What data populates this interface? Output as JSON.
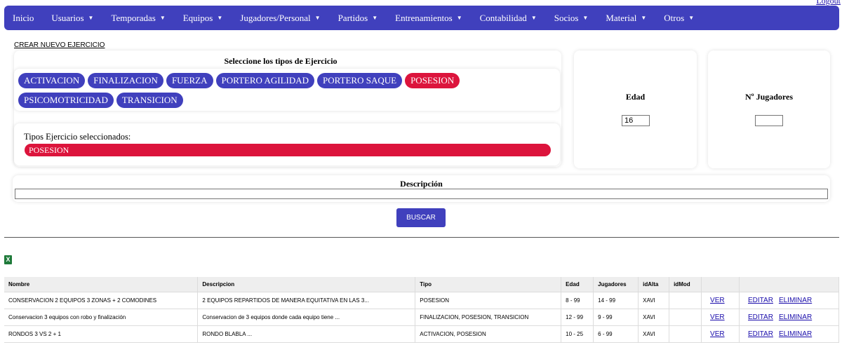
{
  "header": {
    "logout_label": "Logout"
  },
  "nav": [
    {
      "label": "Inicio",
      "has_menu": false
    },
    {
      "label": "Usuarios",
      "has_menu": true
    },
    {
      "label": "Temporadas",
      "has_menu": true
    },
    {
      "label": "Equipos",
      "has_menu": true
    },
    {
      "label": "Jugadores/Personal",
      "has_menu": true
    },
    {
      "label": "Partidos",
      "has_menu": true
    },
    {
      "label": "Entrenamientos",
      "has_menu": true
    },
    {
      "label": "Contabilidad",
      "has_menu": true
    },
    {
      "label": "Socios",
      "has_menu": true
    },
    {
      "label": "Material",
      "has_menu": true
    },
    {
      "label": "Otros",
      "has_menu": true
    }
  ],
  "create_link": "CREAR NUEVO EJERCICIO",
  "types_section": {
    "title": "Seleccione los tipos de Ejercicio",
    "chips": [
      {
        "label": "ACTIVACION",
        "selected": false
      },
      {
        "label": "FINALIZACION",
        "selected": false
      },
      {
        "label": "FUERZA",
        "selected": false
      },
      {
        "label": "PORTERO AGILIDAD",
        "selected": false
      },
      {
        "label": "PORTERO SAQUE",
        "selected": false
      },
      {
        "label": "POSESION",
        "selected": true
      },
      {
        "label": "PSICOMOTRICIDAD",
        "selected": false
      },
      {
        "label": "TRANSICION",
        "selected": false
      }
    ],
    "selected_label": "Tipos Ejercicio seleccionados:",
    "selected_value": "POSESION"
  },
  "age_field": {
    "label": "Edad",
    "value": "16"
  },
  "players_field": {
    "label": "Nº Jugadores",
    "value": ""
  },
  "description_field": {
    "label": "Descripción",
    "value": ""
  },
  "search_button": "BUSCAR",
  "excel_icon": "X",
  "table": {
    "headers": [
      "Nombre",
      "Descripcion",
      "Tipo",
      "Edad",
      "Jugadores",
      "idAlta",
      "idMod",
      "",
      ""
    ],
    "rows": [
      {
        "nombre": "CONSERVACION 2 EQUIPOS 3 ZONAS + 2 COMODINES",
        "descripcion": "2 EQUIPOS REPARTIDOS DE MANERA EQUITATIVA EN LAS 3...",
        "tipo": "POSESION",
        "edad": "8 - 99",
        "jugadores": "14 - 99",
        "idAlta": "XAVI",
        "idMod": "",
        "ver": "VER",
        "editar": "EDITAR",
        "eliminar": "ELIMINAR"
      },
      {
        "nombre": "Conservacion 3 equipos con robo y finalización",
        "descripcion": "Conservacion de 3 equipos donde cada equipo tiene ...",
        "tipo": "FINALIZACION, POSESION, TRANSICION",
        "edad": "12 - 99",
        "jugadores": "9 - 99",
        "idAlta": "XAVI",
        "idMod": "",
        "ver": "VER",
        "editar": "EDITAR",
        "eliminar": "ELIMINAR"
      },
      {
        "nombre": "RONDOS  3 VS 2 + 1",
        "descripcion": "RONDO BLABLA ...",
        "tipo": "ACTIVACION, POSESION",
        "edad": "10 - 25",
        "jugadores": "6 - 99",
        "idAlta": "XAVI",
        "idMod": "",
        "ver": "VER",
        "editar": "EDITAR",
        "eliminar": "ELIMINAR"
      }
    ]
  },
  "colors": {
    "primary": "#4040bd",
    "selected": "#dc143c",
    "link": "#1a0dab",
    "excel": "#1f7a3a"
  }
}
